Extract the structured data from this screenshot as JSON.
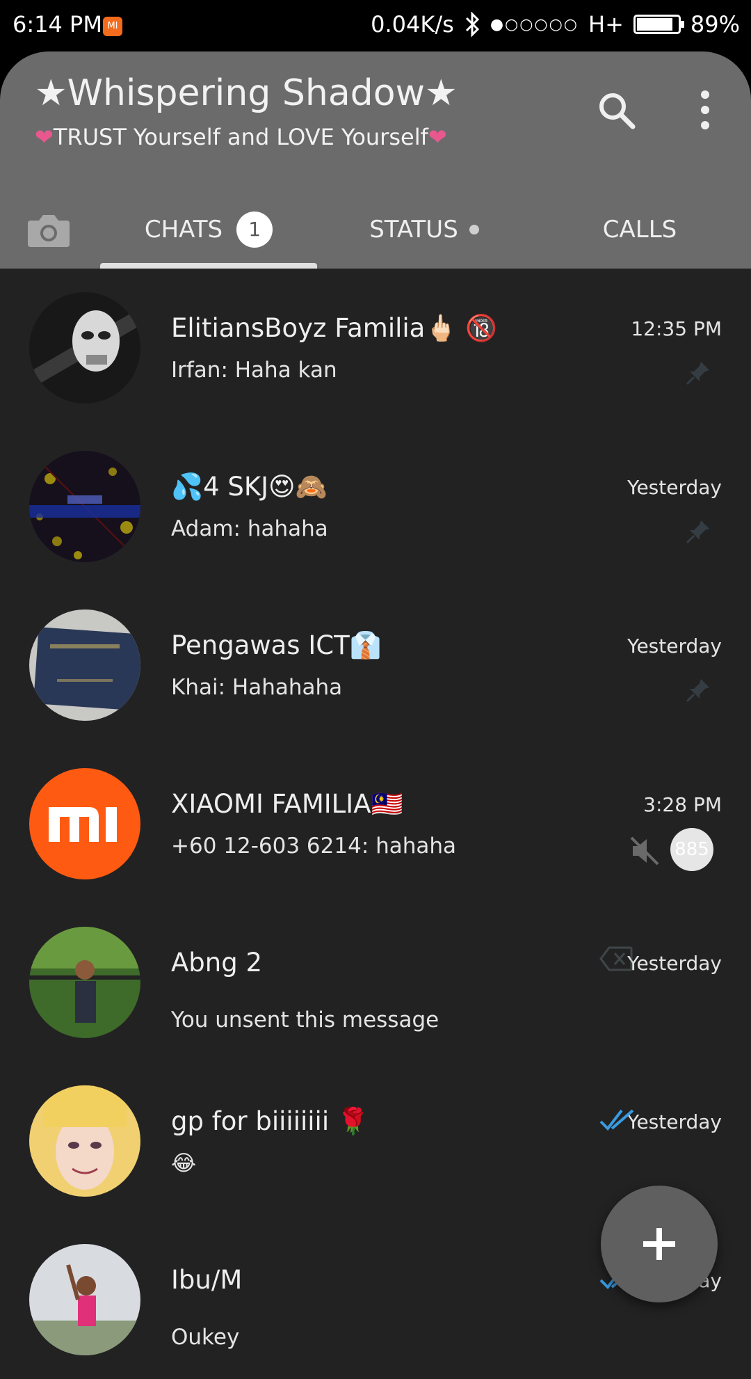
{
  "status_bar": {
    "time": "6:14 PM",
    "mi_icon": "MI",
    "net_speed": "0.04K/s",
    "signal_dots": "●○○○○○",
    "network": "H+",
    "battery_level": 0.89,
    "battery_pct": "89%"
  },
  "header": {
    "title": "★Whispering Shadow★",
    "subtitle_heart": "❤",
    "subtitle": "TRUST Yourself and LOVE Yourself",
    "icons": [
      "search-icon",
      "more-vertical-icon"
    ]
  },
  "tabs": {
    "camera_icon": "camera-icon",
    "chats_label": "CHATS",
    "chats_badge": "1",
    "status_label": "STATUS",
    "calls_label": "CALLS",
    "active": "CHATS"
  },
  "chats": [
    {
      "name": "ElitiansBoyz Familia🖕🏻 🔞",
      "message": "Irfan: Haha kan",
      "time": "12:35 PM",
      "pinned": true
    },
    {
      "name": "💦4 SKJ😍🙈",
      "message": "Adam: hahaha",
      "time": "Yesterday",
      "pinned": true
    },
    {
      "name": "Pengawas ICT👔",
      "message": "Khai: Hahahaha",
      "time": "Yesterday",
      "pinned": true
    },
    {
      "name": "XIAOMI FAMILIA🇲🇾",
      "message": "+60 12-603 6214: hahaha",
      "time": "3:28 PM",
      "muted": true,
      "unread": "885"
    },
    {
      "name": "Abng 2",
      "message": "You unsent this message",
      "time": "Yesterday"
    },
    {
      "name": "gp for biiiiiiii 🌹",
      "message": "😂",
      "time": "Yesterday",
      "read_ticks": true
    },
    {
      "name": "Ibu/M",
      "message": "Oukey",
      "time": "Yesterday",
      "read_ticks": true
    }
  ],
  "fab": {
    "icon": "plus-icon",
    "symbol": "+"
  },
  "colors": {
    "appbar": "#6b6b6b",
    "background": "#222222",
    "heart": "#e8588e",
    "tick_blue": "#3a9be0",
    "mi_orange": "#ff5a12"
  }
}
